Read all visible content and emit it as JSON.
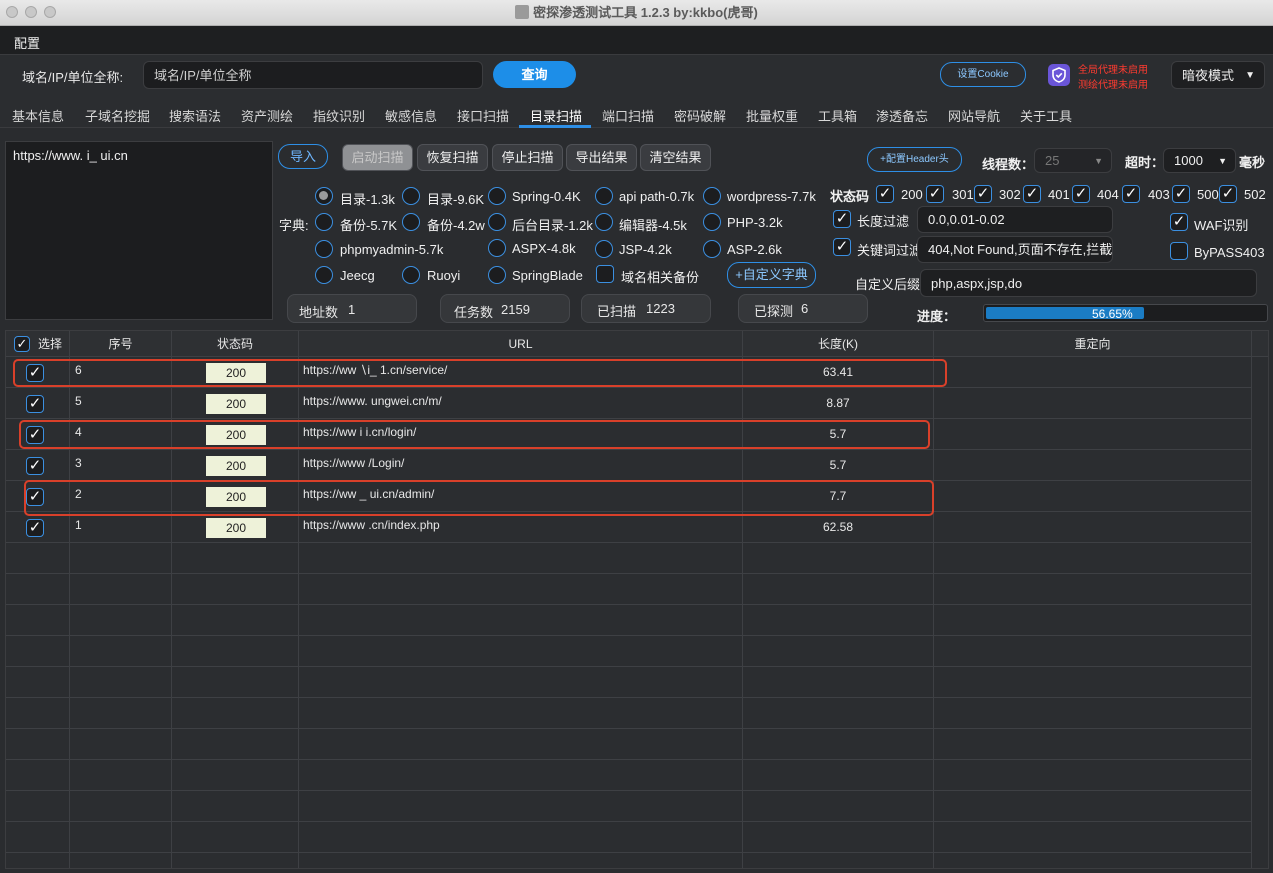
{
  "window": {
    "title": "密探渗透测试工具 1.2.3 by:kkbo(虎哥)"
  },
  "menu": {
    "config": "配置"
  },
  "query": {
    "label": "域名/IP/单位全称:",
    "placeholder": "域名/IP/单位全称",
    "button": "查询",
    "cookie_button": "设置Cookie",
    "proxy_status_1": "全局代理未启用",
    "proxy_status_2": "测绘代理未启用",
    "theme_select": "暗夜模式"
  },
  "tabs": [
    "基本信息",
    "子域名挖掘",
    "搜索语法",
    "资产测绘",
    "指纹识别",
    "敏感信息",
    "接口扫描",
    "目录扫描",
    "端口扫描",
    "密码破解",
    "批量权重",
    "工具箱",
    "渗透备忘",
    "网站导航",
    "关于工具"
  ],
  "active_tab": "目录扫描",
  "targets": {
    "text": "https://www.  i_  ui.cn"
  },
  "actions": {
    "import": "导入",
    "start": "启动扫描",
    "resume": "恢复扫描",
    "stop": "停止扫描",
    "export": "导出结果",
    "clear": "清空结果",
    "header": "+配置Header头"
  },
  "dict": {
    "label": "字典:",
    "options": [
      {
        "label": "目录-1.3k",
        "selected": true
      },
      {
        "label": "目录-9.6K",
        "selected": false
      },
      {
        "label": "Spring-0.4K",
        "selected": false
      },
      {
        "label": "api path-0.7k",
        "selected": false
      },
      {
        "label": "wordpress-7.7k",
        "selected": false
      },
      {
        "label": "备份-5.7K",
        "selected": false
      },
      {
        "label": "备份-4.2w",
        "selected": false
      },
      {
        "label": "后台目录-1.2k",
        "selected": false
      },
      {
        "label": "编辑器-4.5k",
        "selected": false
      },
      {
        "label": "PHP-3.2k",
        "selected": false
      },
      {
        "label": "phpmyadmin-5.7k",
        "selected": false
      },
      {
        "label": "ASPX-4.8k",
        "selected": false
      },
      {
        "label": "JSP-4.2k",
        "selected": false
      },
      {
        "label": "ASP-2.6k",
        "selected": false
      },
      {
        "label": "Jeecg",
        "selected": false
      },
      {
        "label": "Ruoyi",
        "selected": false
      },
      {
        "label": "SpringBlade",
        "selected": false
      }
    ],
    "domain_backup": "域名相关备份",
    "custom_dict": "+自定义字典"
  },
  "settings": {
    "threads_label": "线程数：",
    "threads_value": "25",
    "timeout_label": "超时：",
    "timeout_value": "1000",
    "timeout_unit": "毫秒",
    "status_label": "状态码",
    "status_codes": [
      "200",
      "301",
      "302",
      "401",
      "404",
      "403",
      "500",
      "502"
    ],
    "length_filter_label": "长度过滤",
    "length_filter_value": "0.0,0.01-0.02",
    "keyword_filter_label": "关键词过滤",
    "keyword_filter_value": "404,Not Found,页面不存在,拦截",
    "waf_label": "WAF识别",
    "bypass_label": "ByPASS403",
    "suffix_label": "自定义后缀",
    "suffix_value": "php,aspx,jsp,do",
    "progress_label": "进度：",
    "progress_text": "56.65%",
    "progress_value": 0.5665
  },
  "stats": {
    "addr_label": "地址数",
    "addr_value": "1",
    "task_label": "任务数",
    "task_value": "2159",
    "scanned_label": "已扫描",
    "scanned_value": "1223",
    "found_label": "已探测",
    "found_value": "6"
  },
  "table": {
    "columns": [
      "选择",
      "序号",
      "状态码",
      "URL",
      "长度(K)",
      "重定向"
    ],
    "rows": [
      {
        "id": "6",
        "code": "200",
        "url": "https://ww     ∖i_    1.cn/service/",
        "len": "63.41",
        "redirect": ""
      },
      {
        "id": "5",
        "code": "200",
        "url": "https://www.  ungwei.cn/m/",
        "len": "8.87",
        "redirect": ""
      },
      {
        "id": "4",
        "code": "200",
        "url": "https://ww   i       i.cn/login/",
        "len": "5.7",
        "redirect": ""
      },
      {
        "id": "3",
        "code": "200",
        "url": "https://www            /Login/",
        "len": "5.7",
        "redirect": ""
      },
      {
        "id": "2",
        "code": "200",
        "url": "https://ww      _   ui.cn/admin/",
        "len": "7.7",
        "redirect": ""
      },
      {
        "id": "1",
        "code": "200",
        "url": "https://www      .cn/index.php",
        "len": "62.58",
        "redirect": ""
      }
    ]
  },
  "colors": {
    "accent": "#2e8fe6",
    "highlight": "#d9402a",
    "code_bg": "#eef2d9"
  }
}
